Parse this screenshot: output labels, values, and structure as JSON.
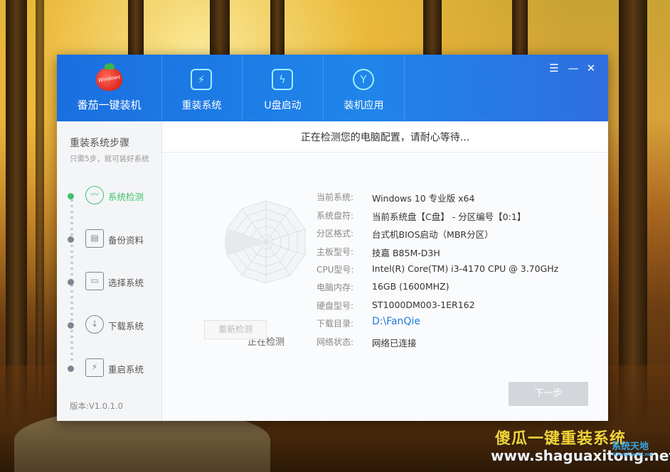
{
  "window": {
    "brand": "番茄一键装机",
    "logo_mini": "Windows",
    "controls": {
      "menu": "☰",
      "minimize": "—",
      "close": "✕"
    }
  },
  "nav": {
    "tabs": [
      {
        "label": "重装系统",
        "icon": "reinstall-icon"
      },
      {
        "label": "U盘启动",
        "icon": "usb-boot-icon"
      },
      {
        "label": "装机应用",
        "icon": "apps-icon"
      }
    ]
  },
  "sidebar": {
    "title": "重装系统步骤",
    "subtitle": "只需5步，就可装好系统",
    "steps": [
      {
        "label": "系统检测",
        "icon": "detect-icon",
        "active": true
      },
      {
        "label": "备份资料",
        "icon": "backup-icon",
        "active": false
      },
      {
        "label": "选择系统",
        "icon": "select-system-icon",
        "active": false
      },
      {
        "label": "下载系统",
        "icon": "download-icon",
        "active": false
      },
      {
        "label": "重启系统",
        "icon": "restart-icon",
        "active": false
      }
    ],
    "version": "版本:V1.0.1.0"
  },
  "main": {
    "status": "正在检测您的电脑配置，请耐心等待...",
    "radar_label": "正在检测",
    "recheck_button": "重新检测",
    "next_button": "下一步",
    "info": [
      {
        "key": "当前系统:",
        "value": "Windows 10 专业版 x64"
      },
      {
        "key": "系统盘符:",
        "value": "当前系统盘【C盘】 - 分区编号【0:1】"
      },
      {
        "key": "分区格式:",
        "value": "台式机BIOS启动（MBR分区）"
      },
      {
        "key": "主板型号:",
        "value": "技嘉 B85M-D3H"
      },
      {
        "key": "CPU型号:",
        "value": "Intel(R) Core(TM) i3-4170 CPU @ 3.70GHz"
      },
      {
        "key": "电脑内存:",
        "value": "16GB (1600MHZ)"
      },
      {
        "key": "硬盘型号:",
        "value": "ST1000DM003-1ER162"
      },
      {
        "key": "下载目录:",
        "value": "D:\\FanQie"
      },
      {
        "key": "网络状态:",
        "value": "网络已连接"
      }
    ]
  },
  "watermark": {
    "title": "傻瓜一键重装系统",
    "url": "www.shaguaxitong.net",
    "logo": "系统天地",
    "logo_sub": "XiTongTianDi.net"
  },
  "colors": {
    "titlebar": "#1f85ea",
    "accent_green": "#3fc36b",
    "link_blue": "#1f7ae0",
    "next_disabled": "#d3d7dc"
  }
}
